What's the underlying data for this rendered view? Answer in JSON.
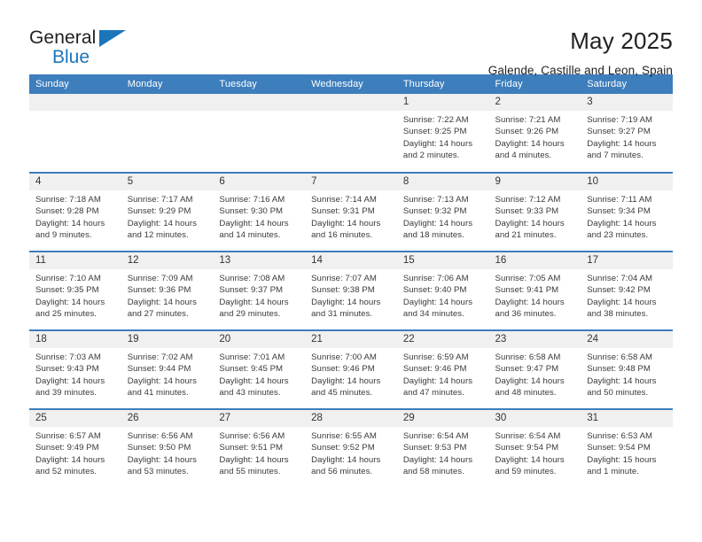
{
  "brand": {
    "name_part1": "General",
    "name_part2": "Blue",
    "accent_color": "#1b75bb",
    "triangle_icon": "brand-triangle-icon"
  },
  "header": {
    "title": "May 2025",
    "subtitle": "Galende, Castille and Leon, Spain"
  },
  "calendar": {
    "header_color": "#3d7ebd",
    "daynum_bg": "#f0f0f0",
    "weekday_headers": [
      "Sunday",
      "Monday",
      "Tuesday",
      "Wednesday",
      "Thursday",
      "Friday",
      "Saturday"
    ],
    "weeks": [
      [
        {
          "day": "",
          "lines": []
        },
        {
          "day": "",
          "lines": []
        },
        {
          "day": "",
          "lines": []
        },
        {
          "day": "",
          "lines": []
        },
        {
          "day": "1",
          "lines": [
            "Sunrise: 7:22 AM",
            "Sunset: 9:25 PM",
            "Daylight: 14 hours",
            "and 2 minutes."
          ]
        },
        {
          "day": "2",
          "lines": [
            "Sunrise: 7:21 AM",
            "Sunset: 9:26 PM",
            "Daylight: 14 hours",
            "and 4 minutes."
          ]
        },
        {
          "day": "3",
          "lines": [
            "Sunrise: 7:19 AM",
            "Sunset: 9:27 PM",
            "Daylight: 14 hours",
            "and 7 minutes."
          ]
        }
      ],
      [
        {
          "day": "4",
          "lines": [
            "Sunrise: 7:18 AM",
            "Sunset: 9:28 PM",
            "Daylight: 14 hours",
            "and 9 minutes."
          ]
        },
        {
          "day": "5",
          "lines": [
            "Sunrise: 7:17 AM",
            "Sunset: 9:29 PM",
            "Daylight: 14 hours",
            "and 12 minutes."
          ]
        },
        {
          "day": "6",
          "lines": [
            "Sunrise: 7:16 AM",
            "Sunset: 9:30 PM",
            "Daylight: 14 hours",
            "and 14 minutes."
          ]
        },
        {
          "day": "7",
          "lines": [
            "Sunrise: 7:14 AM",
            "Sunset: 9:31 PM",
            "Daylight: 14 hours",
            "and 16 minutes."
          ]
        },
        {
          "day": "8",
          "lines": [
            "Sunrise: 7:13 AM",
            "Sunset: 9:32 PM",
            "Daylight: 14 hours",
            "and 18 minutes."
          ]
        },
        {
          "day": "9",
          "lines": [
            "Sunrise: 7:12 AM",
            "Sunset: 9:33 PM",
            "Daylight: 14 hours",
            "and 21 minutes."
          ]
        },
        {
          "day": "10",
          "lines": [
            "Sunrise: 7:11 AM",
            "Sunset: 9:34 PM",
            "Daylight: 14 hours",
            "and 23 minutes."
          ]
        }
      ],
      [
        {
          "day": "11",
          "lines": [
            "Sunrise: 7:10 AM",
            "Sunset: 9:35 PM",
            "Daylight: 14 hours",
            "and 25 minutes."
          ]
        },
        {
          "day": "12",
          "lines": [
            "Sunrise: 7:09 AM",
            "Sunset: 9:36 PM",
            "Daylight: 14 hours",
            "and 27 minutes."
          ]
        },
        {
          "day": "13",
          "lines": [
            "Sunrise: 7:08 AM",
            "Sunset: 9:37 PM",
            "Daylight: 14 hours",
            "and 29 minutes."
          ]
        },
        {
          "day": "14",
          "lines": [
            "Sunrise: 7:07 AM",
            "Sunset: 9:38 PM",
            "Daylight: 14 hours",
            "and 31 minutes."
          ]
        },
        {
          "day": "15",
          "lines": [
            "Sunrise: 7:06 AM",
            "Sunset: 9:40 PM",
            "Daylight: 14 hours",
            "and 34 minutes."
          ]
        },
        {
          "day": "16",
          "lines": [
            "Sunrise: 7:05 AM",
            "Sunset: 9:41 PM",
            "Daylight: 14 hours",
            "and 36 minutes."
          ]
        },
        {
          "day": "17",
          "lines": [
            "Sunrise: 7:04 AM",
            "Sunset: 9:42 PM",
            "Daylight: 14 hours",
            "and 38 minutes."
          ]
        }
      ],
      [
        {
          "day": "18",
          "lines": [
            "Sunrise: 7:03 AM",
            "Sunset: 9:43 PM",
            "Daylight: 14 hours",
            "and 39 minutes."
          ]
        },
        {
          "day": "19",
          "lines": [
            "Sunrise: 7:02 AM",
            "Sunset: 9:44 PM",
            "Daylight: 14 hours",
            "and 41 minutes."
          ]
        },
        {
          "day": "20",
          "lines": [
            "Sunrise: 7:01 AM",
            "Sunset: 9:45 PM",
            "Daylight: 14 hours",
            "and 43 minutes."
          ]
        },
        {
          "day": "21",
          "lines": [
            "Sunrise: 7:00 AM",
            "Sunset: 9:46 PM",
            "Daylight: 14 hours",
            "and 45 minutes."
          ]
        },
        {
          "day": "22",
          "lines": [
            "Sunrise: 6:59 AM",
            "Sunset: 9:46 PM",
            "Daylight: 14 hours",
            "and 47 minutes."
          ]
        },
        {
          "day": "23",
          "lines": [
            "Sunrise: 6:58 AM",
            "Sunset: 9:47 PM",
            "Daylight: 14 hours",
            "and 48 minutes."
          ]
        },
        {
          "day": "24",
          "lines": [
            "Sunrise: 6:58 AM",
            "Sunset: 9:48 PM",
            "Daylight: 14 hours",
            "and 50 minutes."
          ]
        }
      ],
      [
        {
          "day": "25",
          "lines": [
            "Sunrise: 6:57 AM",
            "Sunset: 9:49 PM",
            "Daylight: 14 hours",
            "and 52 minutes."
          ]
        },
        {
          "day": "26",
          "lines": [
            "Sunrise: 6:56 AM",
            "Sunset: 9:50 PM",
            "Daylight: 14 hours",
            "and 53 minutes."
          ]
        },
        {
          "day": "27",
          "lines": [
            "Sunrise: 6:56 AM",
            "Sunset: 9:51 PM",
            "Daylight: 14 hours",
            "and 55 minutes."
          ]
        },
        {
          "day": "28",
          "lines": [
            "Sunrise: 6:55 AM",
            "Sunset: 9:52 PM",
            "Daylight: 14 hours",
            "and 56 minutes."
          ]
        },
        {
          "day": "29",
          "lines": [
            "Sunrise: 6:54 AM",
            "Sunset: 9:53 PM",
            "Daylight: 14 hours",
            "and 58 minutes."
          ]
        },
        {
          "day": "30",
          "lines": [
            "Sunrise: 6:54 AM",
            "Sunset: 9:54 PM",
            "Daylight: 14 hours",
            "and 59 minutes."
          ]
        },
        {
          "day": "31",
          "lines": [
            "Sunrise: 6:53 AM",
            "Sunset: 9:54 PM",
            "Daylight: 15 hours",
            "and 1 minute."
          ]
        }
      ]
    ]
  }
}
